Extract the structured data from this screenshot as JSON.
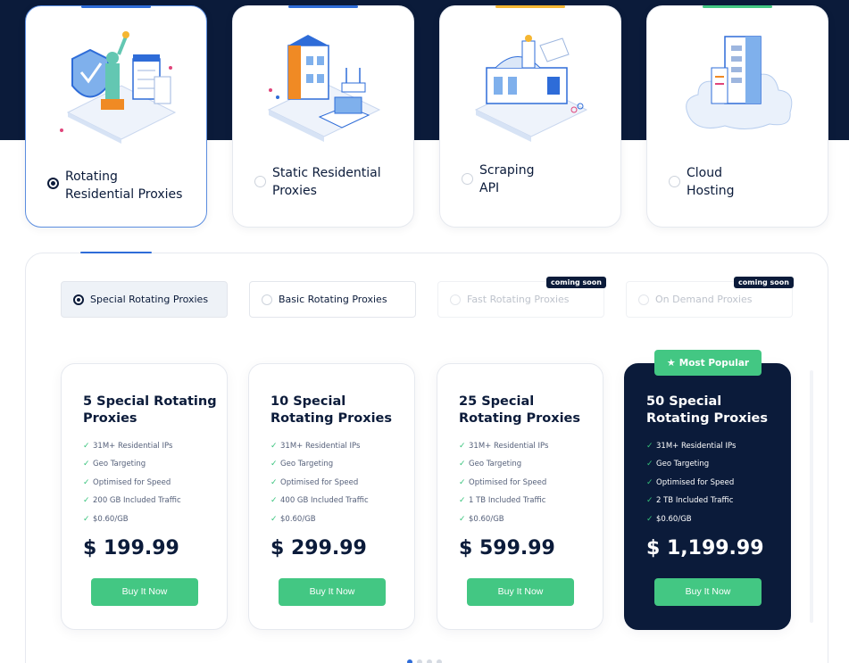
{
  "products": [
    {
      "label_line1": "Rotating",
      "label_line2": "Residential Proxies",
      "selected": true,
      "accent": "#2e6cd8"
    },
    {
      "label_line1": "Static Residential",
      "label_line2": "Proxies",
      "selected": false,
      "accent": "#2e6cd8"
    },
    {
      "label_line1": "Scraping",
      "label_line2": "API",
      "selected": false,
      "accent": "#f5b631"
    },
    {
      "label_line1": "Cloud",
      "label_line2": "Hosting",
      "selected": false,
      "accent": "#43c783"
    }
  ],
  "tabs": [
    {
      "label": "Special Rotating Proxies",
      "state": "active"
    },
    {
      "label": "Basic Rotating Proxies",
      "state": "normal"
    },
    {
      "label": "Fast Rotating Proxies",
      "state": "disabled",
      "badge": "coming soon"
    },
    {
      "label": "On Demand Proxies",
      "state": "disabled",
      "badge": "coming soon"
    }
  ],
  "plans": [
    {
      "title": "5 Special Rotating Proxies",
      "features": [
        "31M+ Residential IPs",
        "Geo Targeting",
        "Optimised for Speed",
        "200 GB Included Traffic",
        "$0.60/GB"
      ],
      "price": "$ 199.99",
      "button": "Buy It Now"
    },
    {
      "title": "10 Special Rotating Proxies",
      "features": [
        "31M+ Residential IPs",
        "Geo Targeting",
        "Optimised for Speed",
        "400 GB Included Traffic",
        "$0.60/GB"
      ],
      "price": "$ 299.99",
      "button": "Buy It Now"
    },
    {
      "title": "25 Special Rotating Proxies",
      "features": [
        "31M+ Residential IPs",
        "Geo Targeting",
        "Optimised for Speed",
        "1 TB Included Traffic",
        "$0.60/GB"
      ],
      "price": "$ 599.99",
      "button": "Buy It Now"
    },
    {
      "title": "50 Special Rotating Proxies",
      "features": [
        "31M+ Residential IPs",
        "Geo Targeting",
        "Optimised for Speed",
        "2 TB Included Traffic",
        "$0.60/GB"
      ],
      "price": "$ 1,199.99",
      "button": "Buy It Now",
      "badge": "Most Popular"
    }
  ],
  "colors": {
    "navy": "#0b1b3a",
    "green": "#43c783",
    "blue": "#2e6cd8",
    "yellow": "#f5b631"
  },
  "carousel": {
    "count": 4,
    "active": 0
  }
}
